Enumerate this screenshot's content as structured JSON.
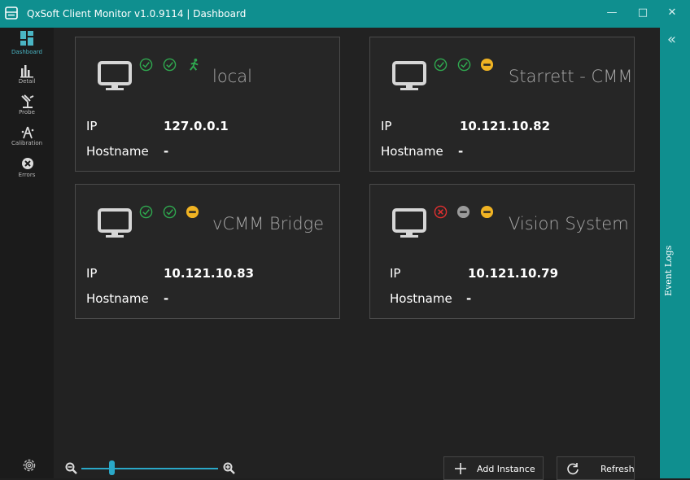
{
  "titlebar": {
    "title": "QxSoft Client Monitor v1.0.9114  |  Dashboard",
    "minimize": "—",
    "maximize": "□",
    "close": "✕"
  },
  "nav": {
    "items": [
      {
        "label": "Dashboard",
        "icon": "dashboard-icon",
        "active": true
      },
      {
        "label": "Detail",
        "icon": "bar-chart-icon"
      },
      {
        "label": "Probe",
        "icon": "probe-icon"
      },
      {
        "label": "Calibration",
        "icon": "calibration-icon"
      },
      {
        "label": "Errors",
        "icon": "error-icon"
      }
    ]
  },
  "event_logs": {
    "label": "Event Logs",
    "collapse_icon": "«"
  },
  "field_labels": {
    "ip": "IP",
    "hostname": "Hostname"
  },
  "instances": [
    {
      "name": "local",
      "ip": "127.0.0.1",
      "hostname": "-",
      "status": [
        "ok",
        "ok",
        "running"
      ]
    },
    {
      "name": "Starrett - CMM",
      "ip": "10.121.10.82",
      "hostname": "-",
      "status": [
        "ok",
        "ok",
        "idle"
      ]
    },
    {
      "name": "vCMM Bridge",
      "ip": "10.121.10.83",
      "hostname": "-",
      "status": [
        "ok",
        "ok",
        "idle"
      ]
    },
    {
      "name": "Vision System",
      "ip": "10.121.10.79",
      "hostname": "-",
      "status": [
        "error",
        "unknown",
        "idle"
      ]
    }
  ],
  "colors": {
    "accent": "#0f8f8f",
    "ok": "#2fa84f",
    "warn": "#f0b323",
    "error": "#e03030",
    "unknown": "#9a9a9a"
  },
  "zoom": {
    "level": 0.2
  },
  "toolbar": {
    "add_label": "Add Instance",
    "refresh_label": "Refresh"
  }
}
